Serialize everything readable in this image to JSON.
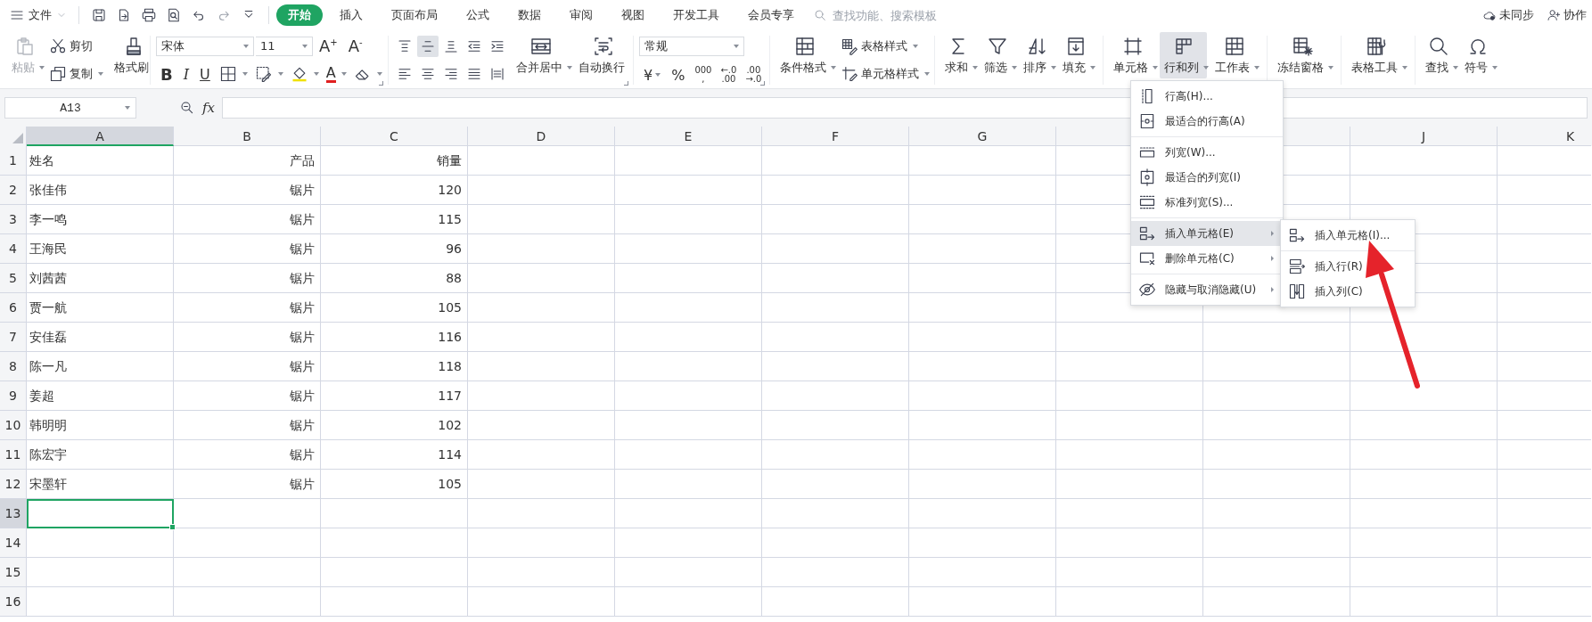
{
  "top_bar": {
    "menu": "文件",
    "tabs": [
      {
        "label": "开始",
        "selected": true
      },
      {
        "label": "插入",
        "selected": false
      },
      {
        "label": "页面布局",
        "selected": false
      },
      {
        "label": "公式",
        "selected": false
      },
      {
        "label": "数据",
        "selected": false
      },
      {
        "label": "审阅",
        "selected": false
      },
      {
        "label": "视图",
        "selected": false
      },
      {
        "label": "开发工具",
        "selected": false
      },
      {
        "label": "会员专享",
        "selected": false
      }
    ],
    "search": {
      "placeholder": "查找功能、搜索模板"
    },
    "sync_status": "未同步",
    "collaborate": "协作"
  },
  "ribbon": {
    "clipboard": {
      "paste": {
        "label": "粘贴",
        "disabled": true
      },
      "cut": "剪切",
      "copy": "复制",
      "format_painter": "格式刷"
    },
    "font": {
      "name": "宋体",
      "size": "11",
      "grow": "A$^{+}$",
      "shrink": "A$^{-}$",
      "bold": "B",
      "italic": "I",
      "underline": "U",
      "font_color": "A"
    },
    "alignment": {
      "vertical": [
        {
          "selected": false
        },
        {
          "selected": true
        },
        {
          "selected": false
        }
      ],
      "merge": "合并居中",
      "wrap": "自动换行"
    },
    "number": {
      "format": "常规",
      "currency": "¥",
      "percent": "%",
      "thousands": [
        "000",
        ","
      ],
      "increase_decimal": [
        "←.0",
        ".00"
      ],
      "decrease_decimal": [
        ".00",
        "→.0"
      ]
    },
    "styles": {
      "conditional": "条件格式",
      "table_style": "表格样式",
      "cell_style": "单元格样式"
    },
    "tool_groups": [
      {
        "buttons": [
          {
            "label": "求和",
            "selected": false
          },
          {
            "label": "筛选",
            "selected": false
          },
          {
            "label": "排序",
            "selected": false
          },
          {
            "label": "填充",
            "selected": false
          }
        ]
      },
      {
        "buttons": [
          {
            "label": "单元格",
            "selected": false
          },
          {
            "label": "行和列",
            "selected": true
          },
          {
            "label": "工作表",
            "selected": false
          }
        ]
      },
      {
        "buttons": [
          {
            "label": "冻结窗格",
            "selected": false
          }
        ]
      },
      {
        "buttons": [
          {
            "label": "表格工具",
            "selected": false
          }
        ]
      },
      {
        "buttons": [
          {
            "label": "查找",
            "selected": false
          },
          {
            "label": "符号",
            "selected": false
          }
        ]
      }
    ]
  },
  "formula_bar": {
    "name_box": "A13",
    "function_label": "fx"
  },
  "sheet": {
    "columns": [
      {
        "label": "A",
        "selected": true
      },
      {
        "label": "B",
        "selected": false
      },
      {
        "label": "C",
        "selected": false
      },
      {
        "label": "D",
        "selected": false
      },
      {
        "label": "E",
        "selected": false
      },
      {
        "label": "F",
        "selected": false
      },
      {
        "label": "G",
        "selected": false
      },
      {
        "selected": false
      },
      {
        "selected": false
      },
      {
        "label": "J",
        "selected": false
      },
      {
        "label": "K",
        "selected": false
      }
    ],
    "rows": [
      {
        "number": "1",
        "selected": false,
        "cells": [
          "姓名",
          "产品",
          "销量"
        ]
      },
      {
        "number": "2",
        "selected": false,
        "cells": [
          "张佳伟",
          "锯片",
          "120"
        ]
      },
      {
        "number": "3",
        "selected": false,
        "cells": [
          "李一鸣",
          "锯片",
          "115"
        ]
      },
      {
        "number": "4",
        "selected": false,
        "cells": [
          "王海民",
          "锯片",
          "96"
        ]
      },
      {
        "number": "5",
        "selected": false,
        "cells": [
          "刘茜茜",
          "锯片",
          "88"
        ]
      },
      {
        "number": "6",
        "selected": false,
        "cells": [
          "贾一航",
          "锯片",
          "105"
        ]
      },
      {
        "number": "7",
        "selected": false,
        "cells": [
          "安佳磊",
          "锯片",
          "116"
        ]
      },
      {
        "number": "8",
        "selected": false,
        "cells": [
          "陈一凡",
          "锯片",
          "118"
        ]
      },
      {
        "number": "9",
        "selected": false,
        "cells": [
          "姜超",
          "锯片",
          "117"
        ]
      },
      {
        "number": "10",
        "selected": false,
        "cells": [
          "韩明明",
          "锯片",
          "102"
        ]
      },
      {
        "number": "11",
        "selected": false,
        "cells": [
          "陈宏宇",
          "锯片",
          "114"
        ]
      },
      {
        "number": "12",
        "selected": false,
        "cells": [
          "宋墨轩",
          "锯片",
          "105"
        ]
      },
      {
        "number": "13",
        "selected": true
      },
      {
        "number": "14",
        "selected": false
      },
      {
        "number": "15",
        "selected": false
      },
      {
        "number": "16",
        "selected": false
      }
    ]
  },
  "dropdown_menu": {
    "sections": [
      [
        {
          "label": "行高(H)...",
          "has_submenu": false,
          "highlighted": false
        },
        {
          "label": "最适合的行高(A)",
          "has_submenu": false,
          "highlighted": false
        }
      ],
      [
        {
          "label": "列宽(W)...",
          "has_submenu": false,
          "highlighted": false
        },
        {
          "label": "最适合的列宽(I)",
          "has_submenu": false,
          "highlighted": false
        },
        {
          "label": "标准列宽(S)...",
          "has_submenu": false,
          "highlighted": false
        }
      ],
      [
        {
          "label": "插入单元格(E)",
          "has_submenu": true,
          "highlighted": true
        },
        {
          "label": "删除单元格(C)",
          "has_submenu": true,
          "highlighted": false
        }
      ],
      [
        {
          "label": "隐藏与取消隐藏(U)",
          "has_submenu": true,
          "highlighted": false
        }
      ]
    ]
  },
  "submenu": {
    "sections": [
      [
        {
          "label": "插入单元格(I)...",
          "highlighted": false
        }
      ],
      [
        {
          "label": "插入行(R)",
          "highlighted": false
        },
        {
          "label": "插入列(C)",
          "highlighted": false
        }
      ]
    ]
  }
}
